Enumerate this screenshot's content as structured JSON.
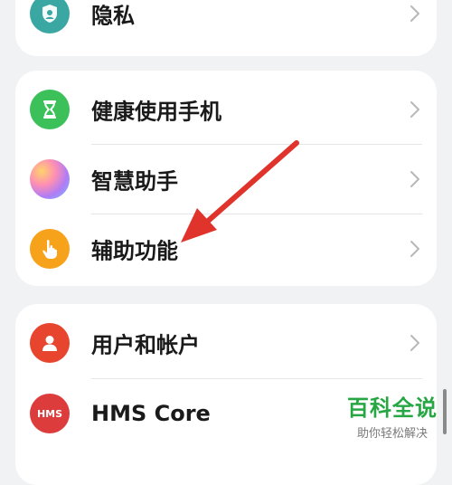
{
  "colors": {
    "background": "#f1f2f4",
    "card": "#ffffff",
    "text": "#1a1a1a",
    "chevron": "#b8b8b8",
    "annotation_arrow": "#e0332b",
    "watermark_green": "#27a644"
  },
  "cards": [
    {
      "items": [
        {
          "label": "隐私",
          "icon": "privacy-shield-icon",
          "icon_color": "#3aa7a3"
        }
      ]
    },
    {
      "items": [
        {
          "label": "健康使用手机",
          "icon": "hourglass-icon",
          "icon_color": "#3cc15a"
        },
        {
          "label": "智慧助手",
          "icon": "smart-assistant-orb-icon",
          "icon_color": "#c27cf2"
        },
        {
          "label": "辅助功能",
          "icon": "hand-pointer-icon",
          "icon_color": "#f7a21b"
        }
      ]
    },
    {
      "items": [
        {
          "label": "用户和帐户",
          "icon": "user-icon",
          "icon_color": "#e8452f"
        },
        {
          "label": "HMS Core",
          "icon": "hms-icon",
          "icon_color": "#dc3c3c",
          "icon_text": "HMS"
        }
      ]
    }
  ],
  "watermark": {
    "title": "百科全说",
    "subtitle": "助你轻松解决"
  }
}
